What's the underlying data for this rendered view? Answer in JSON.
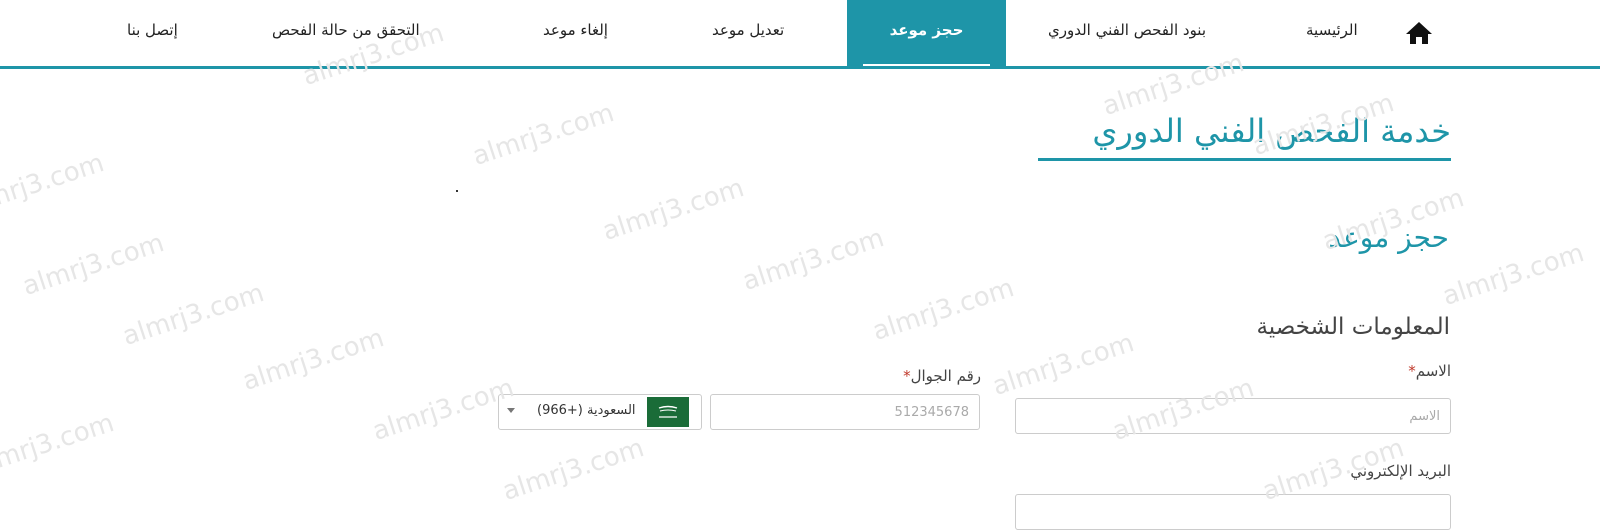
{
  "nav": {
    "home": "الرئيسية",
    "inspection_terms": "بنود الفحص الفني الدوري",
    "book": "حجز موعد",
    "modify": "تعديل موعد",
    "cancel": "إلغاء موعد",
    "status": "التحقق من حالة الفحص",
    "contact": "إتصل بنا"
  },
  "page": {
    "title": "خدمة الفحص الفني الدوري",
    "section": "حجز موعد",
    "subsection": "المعلومات الشخصية"
  },
  "form": {
    "name_label": "الاسم",
    "name_placeholder": "الاسم",
    "mobile_label": "رقم الجوال",
    "mobile_placeholder": "512345678",
    "country_value": "(966+) السعودية",
    "email_label": "البريد الإلكتروني",
    "required_mark": "*"
  },
  "watermark": "almrj3.com",
  "colors": {
    "accent": "#1e95a8",
    "required": "#c0392b",
    "flag": "#1a6c38"
  }
}
